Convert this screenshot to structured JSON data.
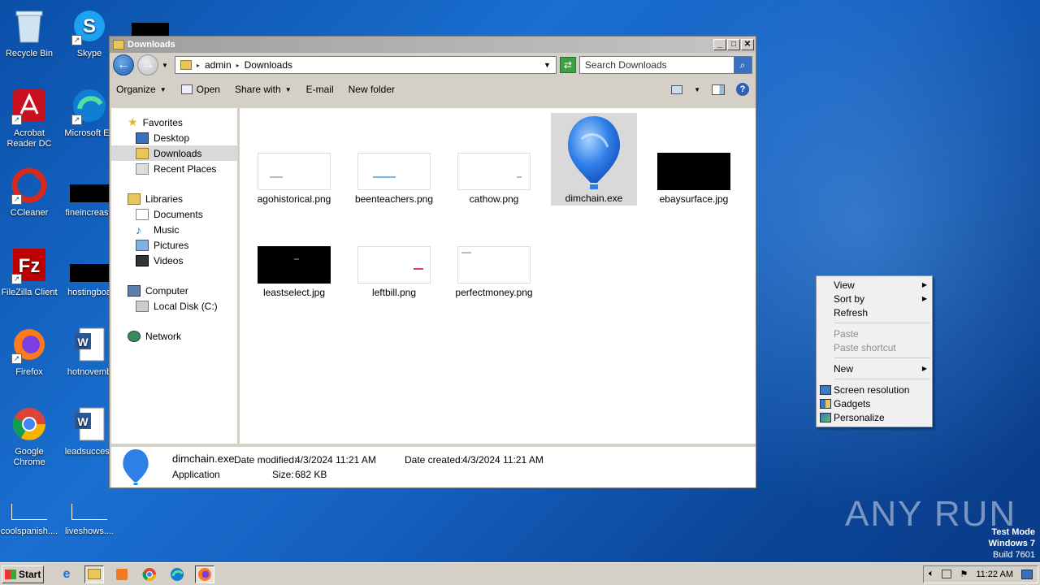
{
  "desktop": {
    "icons": [
      {
        "label": "Recycle Bin",
        "icon": "recycle-bin-icon"
      },
      {
        "label": "Skype",
        "icon": "skype-icon"
      },
      {
        "label": "Acrobat Reader DC",
        "icon": "acrobat-icon"
      },
      {
        "label": "Microsoft Ed",
        "icon": "edge-icon"
      },
      {
        "label": "CCleaner",
        "icon": "ccleaner-icon"
      },
      {
        "label": "fineincrease",
        "icon": "image-file-icon"
      },
      {
        "label": "FileZilla Client",
        "icon": "filezilla-icon"
      },
      {
        "label": "hostingboa",
        "icon": "image-file-icon"
      },
      {
        "label": "Firefox",
        "icon": "firefox-icon"
      },
      {
        "label": "hotnovemb",
        "icon": "word-doc-icon"
      },
      {
        "label": "Google Chrome",
        "icon": "chrome-icon"
      },
      {
        "label": "leadsuccess",
        "icon": "word-doc-icon"
      },
      {
        "label": "coolspanish....",
        "icon": "image-file-icon"
      },
      {
        "label": "liveshows....",
        "icon": "image-file-icon"
      }
    ]
  },
  "window": {
    "title": "Downloads",
    "address": {
      "root": "admin",
      "current": "Downloads"
    },
    "search_placeholder": "Search Downloads",
    "toolbar": {
      "organize": "Organize",
      "open": "Open",
      "share_with": "Share with",
      "email": "E-mail",
      "new_folder": "New folder"
    },
    "nav": {
      "favorites": "Favorites",
      "desktop": "Desktop",
      "downloads": "Downloads",
      "recent": "Recent Places",
      "libraries": "Libraries",
      "documents": "Documents",
      "music": "Music",
      "pictures": "Pictures",
      "videos": "Videos",
      "computer": "Computer",
      "local_disk": "Local Disk (C:)",
      "network": "Network"
    },
    "files": [
      {
        "name": "agohistorical.png"
      },
      {
        "name": "beenteachers.png"
      },
      {
        "name": "cathow.png"
      },
      {
        "name": "dimchain.exe"
      },
      {
        "name": "ebaysurface.jpg"
      },
      {
        "name": "leastselect.jpg"
      },
      {
        "name": "leftbill.png"
      },
      {
        "name": "perfectmoney.png"
      }
    ],
    "details": {
      "name": "dimchain.exe",
      "type": "Application",
      "modified_label": "Date modified:",
      "modified": "4/3/2024 11:21 AM",
      "created_label": "Date created:",
      "created": "4/3/2024 11:21 AM",
      "size_label": "Size:",
      "size": "682 KB"
    }
  },
  "context_menu": {
    "view": "View",
    "sort_by": "Sort by",
    "refresh": "Refresh",
    "paste": "Paste",
    "paste_shortcut": "Paste shortcut",
    "new": "New",
    "screen_resolution": "Screen resolution",
    "gadgets": "Gadgets",
    "personalize": "Personalize"
  },
  "watermark": "ANY RUN",
  "build_info": {
    "line1": "Test Mode",
    "line2": "Windows 7",
    "line3": "Build 7601"
  },
  "taskbar": {
    "start": "Start",
    "clock": "11:22 AM"
  }
}
